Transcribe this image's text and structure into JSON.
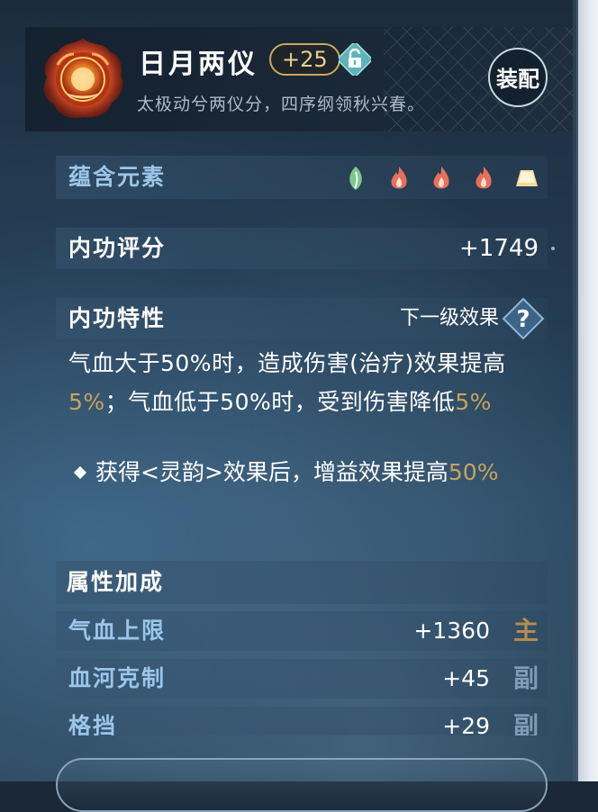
{
  "header": {
    "title": "日月两仪",
    "level": "+25",
    "subtitle": "太极动兮两仪分，四序纲领秋兴春。",
    "equip_label": "装配"
  },
  "elements": {
    "label": "蕴含元素",
    "icons": [
      "leaf-icon",
      "fire-icon",
      "fire-icon",
      "fire-icon",
      "earth-icon"
    ]
  },
  "score": {
    "label": "内功评分",
    "value": "+1749"
  },
  "trait": {
    "label": "内功特性",
    "next_label": "下一级效果",
    "desc_1": "气血大于50%时，造成伤害(治疗)效果提高",
    "desc_2": "5%",
    "desc_3": "；气血低于50%时，受到伤害降低",
    "desc_4": "5%",
    "bullet_text": "获得<灵韵>效果后，增益效果提高",
    "bullet_value": "50%"
  },
  "attributes": {
    "header": "属性加成",
    "rows": [
      {
        "name": "气血上限",
        "value": "+1360",
        "tag": "主"
      },
      {
        "name": "血河克制",
        "value": "+45",
        "tag": "副"
      },
      {
        "name": "格挡",
        "value": "+29",
        "tag": "副"
      }
    ]
  },
  "colors": {
    "gold": "#c9a35b",
    "attr_blue": "#9cc6e8",
    "badge_border": "#c9a95a"
  }
}
